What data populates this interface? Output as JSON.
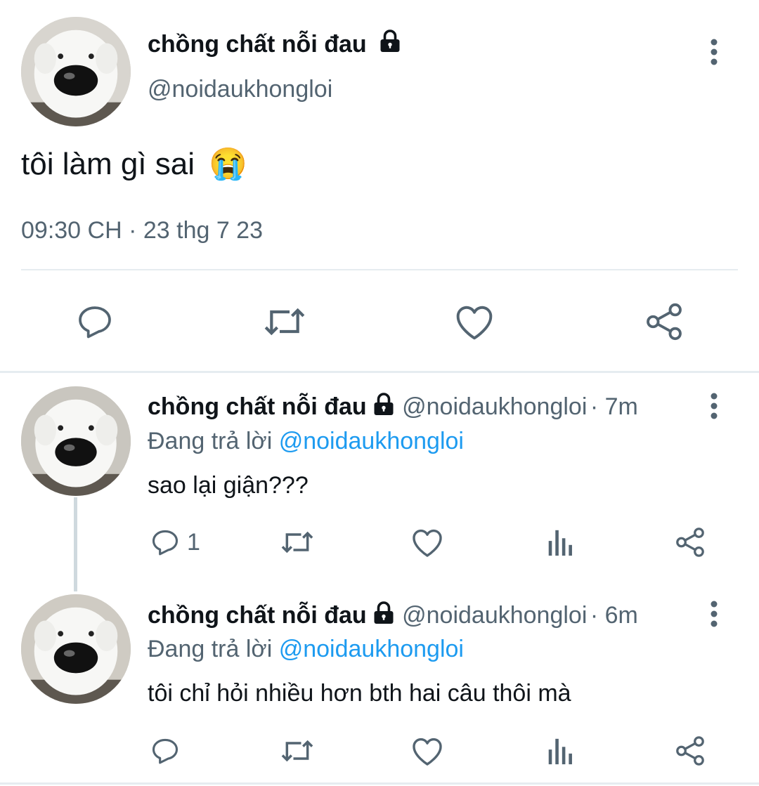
{
  "main_tweet": {
    "display_name": "chồng chất nỗi đau",
    "handle": "@noidaukhongloi",
    "text": "tôi làm gì sai",
    "emoji": "😭",
    "timestamp": "09:30 CH · 23 thg 7 23",
    "actions": [
      "reply-icon",
      "retweet-icon",
      "like-icon",
      "share-icon"
    ]
  },
  "replies": [
    {
      "display_name": "chồng chất nỗi đau",
      "handle": "@noidaukhongloi",
      "time": "· 7m",
      "replying_to_label": "Đang trả lời",
      "replying_to_handle": "@noidaukhongloi",
      "text": "sao lại giận???",
      "reply_count": "1"
    },
    {
      "display_name": "chồng chất nỗi đau",
      "handle": "@noidaukhongloi",
      "time": "· 6m",
      "replying_to_label": "Đang trả lời",
      "replying_to_handle": "@noidaukhongloi",
      "text": "tôi chỉ hỏi nhiều hơn bth hai câu thôi mà",
      "reply_count": ""
    }
  ],
  "colors": {
    "text": "#0f1419",
    "secondary": "#536471",
    "link": "#1d9bf0",
    "divider": "#e6ecf0"
  }
}
